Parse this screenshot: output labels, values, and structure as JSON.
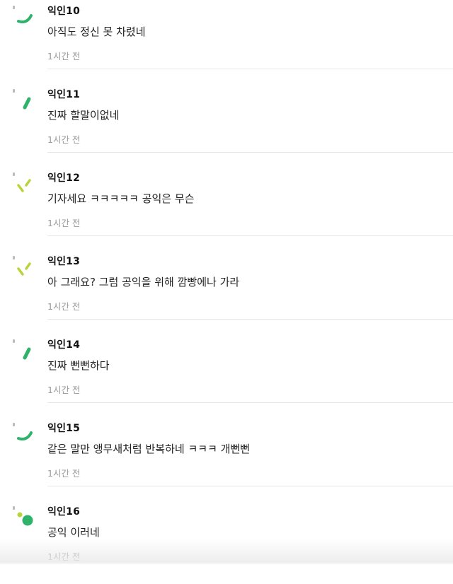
{
  "colors": {
    "green": "#2fb36b",
    "lime": "#b9d43a",
    "author": "#111111",
    "text": "#222222",
    "time": "#999999",
    "divider": "#e6e6e6"
  },
  "comments": [
    {
      "author": "익인10",
      "text": "아직도 정신 못 차렸네",
      "time": "1시간 전",
      "avatar_icon": "arc-avatar-icon"
    },
    {
      "author": "익인11",
      "text": "진짜 할말이없네",
      "time": "1시간 전",
      "avatar_icon": "dash-avatar-icon"
    },
    {
      "author": "익인12",
      "text": "기자세요 ㅋㅋㅋㅋㅋ 공익은 무슨",
      "time": "1시간 전",
      "avatar_icon": "check-avatar-icon"
    },
    {
      "author": "익인13",
      "text": "아 그래요? 그럼 공익을 위해 깜빵에나 가라",
      "time": "1시간 전",
      "avatar_icon": "check-avatar-icon"
    },
    {
      "author": "익인14",
      "text": "진짜 뻔뻔하다",
      "time": "1시간 전",
      "avatar_icon": "dash-avatar-icon"
    },
    {
      "author": "익인15",
      "text": "같은 말만 앵무새처럼 반복하네 ㅋㅋㅋ 개뻔뻔",
      "time": "1시간 전",
      "avatar_icon": "arc-avatar-icon"
    },
    {
      "author": "익인16",
      "text": "공익 이러네",
      "time": "1시간 전",
      "avatar_icon": "dots-avatar-icon"
    }
  ]
}
